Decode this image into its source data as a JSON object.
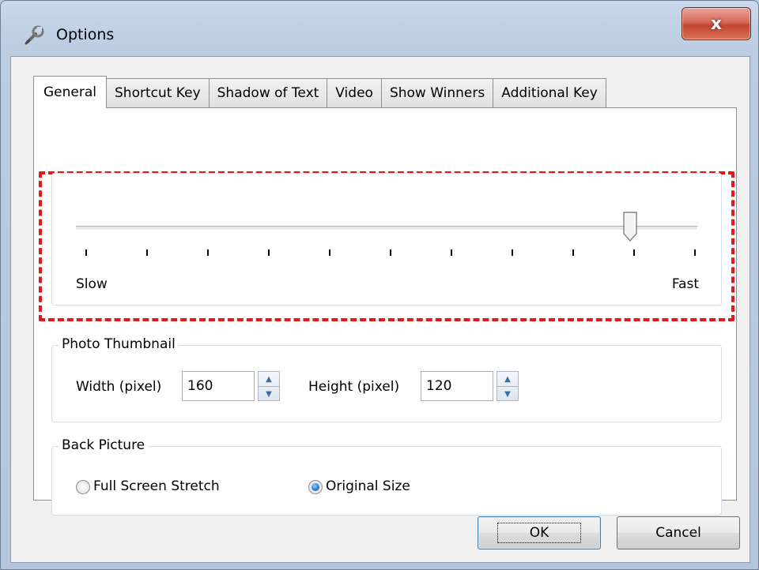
{
  "window": {
    "title": "Options",
    "close_label": "x"
  },
  "tabs": [
    "General",
    "Shortcut Key",
    "Shadow of Text",
    "Video",
    "Show Winners",
    "Additional Key"
  ],
  "speed": {
    "min_label": "Slow",
    "max_label": "Fast",
    "tick_count": 11,
    "value_fraction": 0.895
  },
  "photo_thumbnail": {
    "title": "Photo Thumbnail",
    "width_label": "Width (pixel)",
    "width_value": "160",
    "height_label": "Height (pixel)",
    "height_value": "120"
  },
  "back_picture": {
    "title": "Back Picture",
    "options": [
      "Full Screen Stretch",
      "Original Size"
    ],
    "selected": "Original Size"
  },
  "buttons": {
    "ok": "OK",
    "cancel": "Cancel"
  },
  "colors": {
    "highlight": "#e01a1a",
    "close": "#c3452f"
  }
}
